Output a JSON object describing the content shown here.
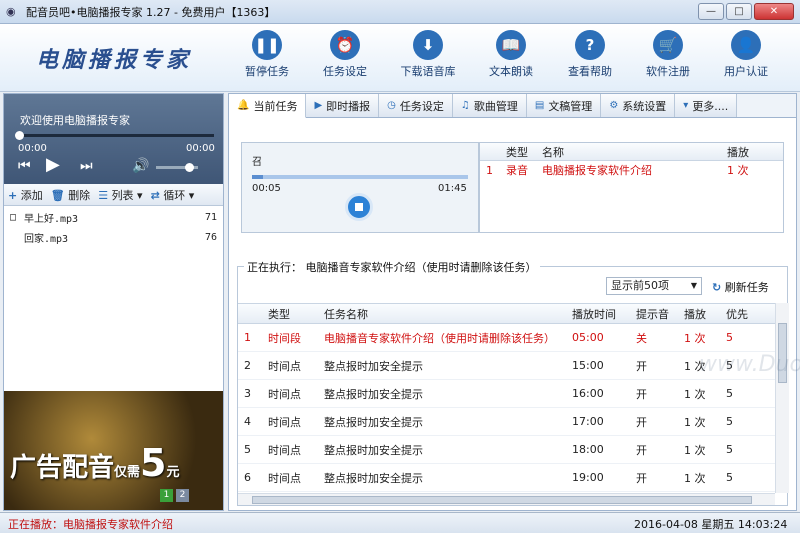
{
  "window": {
    "title": "配音员吧•电脑播报专家 1.27 - 免费用户【1363】",
    "min": "—",
    "max": "□",
    "close": "✕"
  },
  "app": {
    "logo": "电脑播报专家"
  },
  "toolbar": [
    {
      "label": "暂停任务",
      "icon": "pause-icon",
      "glyph": "❚❚"
    },
    {
      "label": "任务设定",
      "icon": "alarm-clock-icon",
      "glyph": "⏰"
    },
    {
      "label": "下载语音库",
      "icon": "download-icon",
      "glyph": "⬇"
    },
    {
      "label": "文本朗读",
      "icon": "book-icon",
      "glyph": "📖"
    },
    {
      "label": "查看帮助",
      "icon": "help-icon",
      "glyph": "?"
    },
    {
      "label": "软件注册",
      "icon": "cart-icon",
      "glyph": "🛒"
    },
    {
      "label": "用户认证",
      "icon": "user-icon",
      "glyph": "👤"
    }
  ],
  "player": {
    "welcome": "欢迎使用电脑播报专家",
    "time_cur": "00:00",
    "time_total": "00:00",
    "progress": 0,
    "volume": 0.8
  },
  "playlist_bar": {
    "add": "添加",
    "del": "删除",
    "list": "列表",
    "loop": "循环"
  },
  "playlist": [
    {
      "check": "□",
      "name": "早上好.mp3",
      "num": "71"
    },
    {
      "check": "",
      "name": "回家.mp3",
      "num": "76"
    }
  ],
  "ad": {
    "text": "广告配音",
    "small": "仅需",
    "num": "5",
    "unit": "元",
    "pages": [
      "1",
      "2"
    ]
  },
  "tabs": [
    "当前任务",
    "即时播报",
    "任务设定",
    "歌曲管理",
    "文稿管理",
    "系统设置",
    "更多...."
  ],
  "current": {
    "name": "召",
    "time_cur": "00:05",
    "time_total": "01:45",
    "progress": 0.05
  },
  "current_table": {
    "headers": [
      "类型",
      "名称",
      "播放"
    ],
    "rows": [
      {
        "idx": "1",
        "type": "录音",
        "name": "电脑播报专家软件介绍",
        "play": "1 次"
      }
    ]
  },
  "executing": {
    "label": "正在执行：",
    "name": "电脑播音专家软件介绍（使用时请删除该任务）",
    "select": "显示前50项",
    "refresh": "刷新任务"
  },
  "tasks": {
    "headers": [
      "",
      "类型",
      "任务名称",
      "播放时间",
      "提示音",
      "播放",
      "优先"
    ],
    "rows": [
      {
        "n": "1",
        "type": "时间段",
        "name": "电脑播音专家软件介绍（使用时请删除该任务）",
        "time": "05:00",
        "tone": "关",
        "play": "1 次",
        "pri": "5",
        "red": true
      },
      {
        "n": "2",
        "type": "时间点",
        "name": "整点报时加安全提示",
        "time": "15:00",
        "tone": "开",
        "play": "1 次",
        "pri": "5",
        "red": false
      },
      {
        "n": "3",
        "type": "时间点",
        "name": "整点报时加安全提示",
        "time": "16:00",
        "tone": "开",
        "play": "1 次",
        "pri": "5",
        "red": false
      },
      {
        "n": "4",
        "type": "时间点",
        "name": "整点报时加安全提示",
        "time": "17:00",
        "tone": "开",
        "play": "1 次",
        "pri": "5",
        "red": false
      },
      {
        "n": "5",
        "type": "时间点",
        "name": "整点报时加安全提示",
        "time": "18:00",
        "tone": "开",
        "play": "1 次",
        "pri": "5",
        "red": false
      },
      {
        "n": "6",
        "type": "时间点",
        "name": "整点报时加安全提示",
        "time": "19:00",
        "tone": "开",
        "play": "1 次",
        "pri": "5",
        "red": false
      }
    ]
  },
  "status": {
    "text": "正在播放：电脑播报专家软件介绍",
    "datetime": "2016-04-08 星期五 14:03:24"
  },
  "watermark": "www.DuoTe.com"
}
